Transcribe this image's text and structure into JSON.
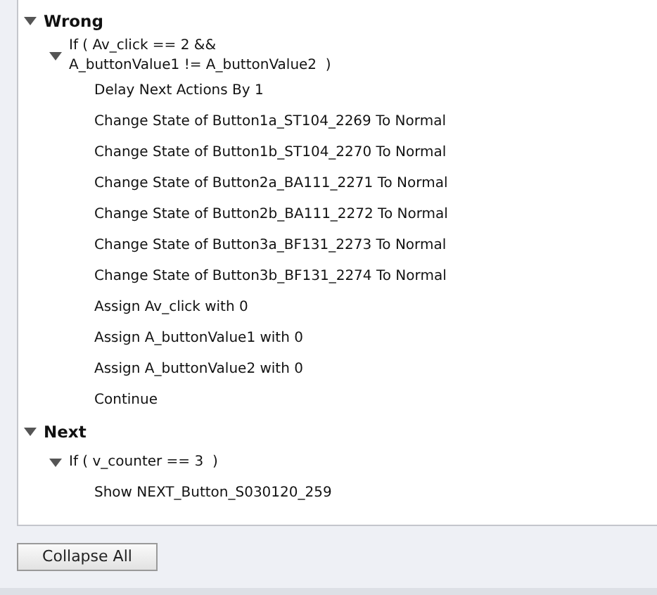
{
  "tree": [
    {
      "label": "Wrong",
      "expanded": true,
      "children": [
        {
          "label": "If ( Av_click == 2 &&\nA_buttonValue1 != A_buttonValue2  )",
          "expanded": true,
          "children": [
            {
              "label": "Delay Next Actions By 1"
            },
            {
              "label": "Change State of Button1a_ST104_2269 To Normal"
            },
            {
              "label": "Change State of Button1b_ST104_2270 To Normal"
            },
            {
              "label": "Change State of Button2a_BA111_2271 To Normal"
            },
            {
              "label": "Change State of Button2b_BA111_2272 To Normal"
            },
            {
              "label": "Change State of Button3a_BF131_2273 To Normal"
            },
            {
              "label": "Change State of Button3b_BF131_2274 To Normal"
            },
            {
              "label": "Assign Av_click with 0"
            },
            {
              "label": "Assign A_buttonValue1 with 0"
            },
            {
              "label": "Assign A_buttonValue2 with 0"
            },
            {
              "label": "Continue"
            }
          ]
        }
      ]
    },
    {
      "label": "Next",
      "expanded": true,
      "children": [
        {
          "label": "If ( v_counter == 3  )",
          "expanded": true,
          "children": [
            {
              "label": "Show NEXT_Button_S030120_259"
            }
          ]
        }
      ]
    }
  ],
  "collapse_button": "Collapse All"
}
